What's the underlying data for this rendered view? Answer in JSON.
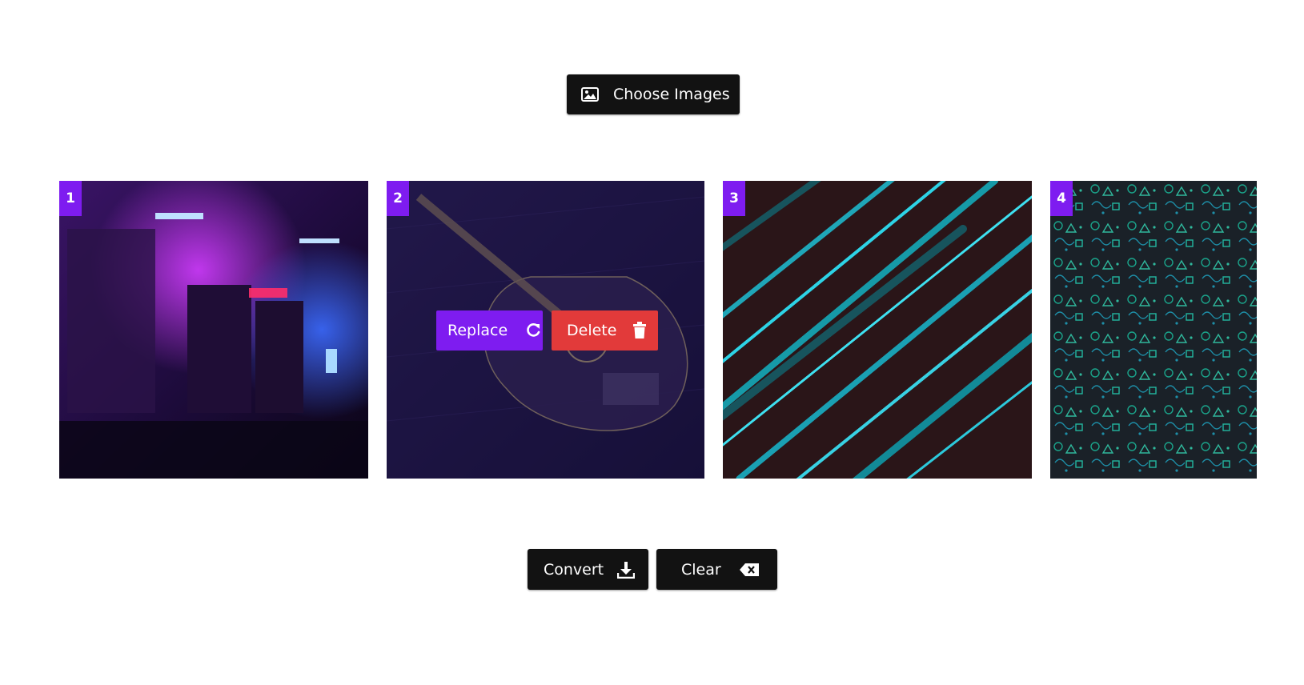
{
  "toolbar": {
    "choose_label": "Choose Images",
    "choose_icon": "image-icon"
  },
  "images": [
    {
      "index": "1",
      "description_icon": "neon-alley-image"
    },
    {
      "index": "2",
      "description_icon": "guitar-image",
      "hovered": true
    },
    {
      "index": "3",
      "description_icon": "teal-stripes-image"
    },
    {
      "index": "4",
      "description_icon": "doodle-pattern-image"
    }
  ],
  "card_actions": {
    "replace_label": "Replace",
    "replace_icon": "refresh-icon",
    "delete_label": "Delete",
    "delete_icon": "trash-icon"
  },
  "footer": {
    "convert_label": "Convert",
    "convert_icon": "download-icon",
    "clear_label": "Clear",
    "clear_icon": "backspace-icon"
  },
  "colors": {
    "accent": "#7e1cf0",
    "danger": "#e23a3a",
    "dark_button": "#121212"
  }
}
